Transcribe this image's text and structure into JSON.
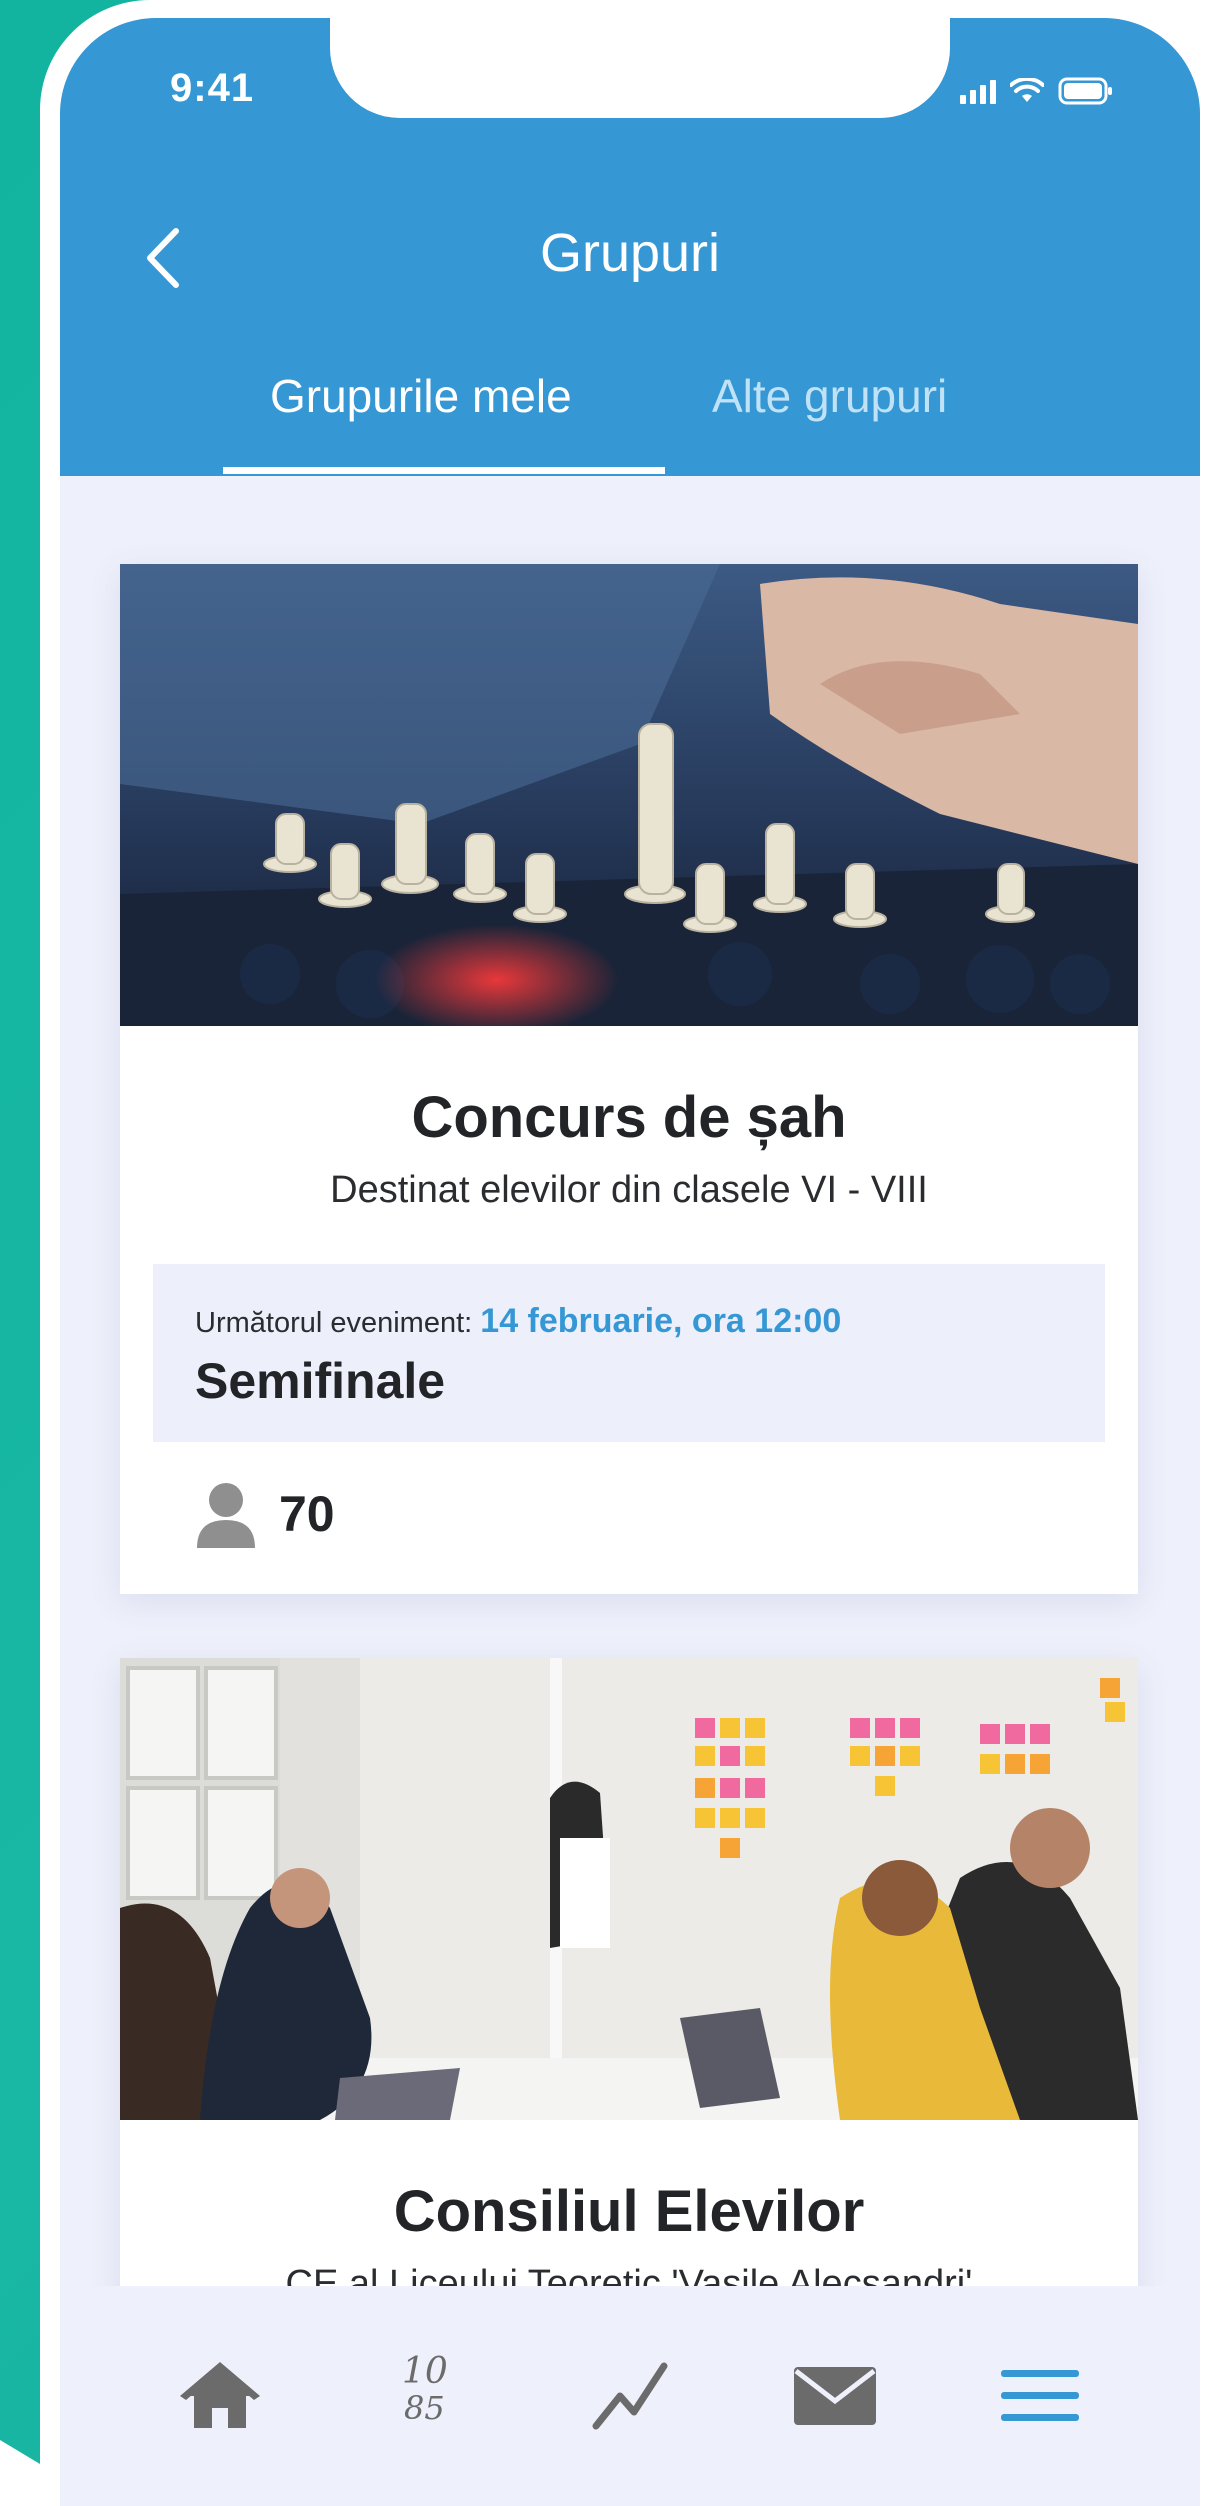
{
  "status_bar": {
    "time": "9:41"
  },
  "header": {
    "title": "Grupuri",
    "tabs": [
      {
        "label": "Grupurile mele",
        "active": true
      },
      {
        "label": "Alte grupuri",
        "active": false
      }
    ]
  },
  "groups": [
    {
      "title": "Concurs de șah",
      "subtitle": "Destinat elevilor din clasele VI - VIII",
      "image": "chess-photo",
      "event_label": "Următorul eveniment:",
      "event_date": "14 februarie, ora 12:00",
      "event_name": "Semifinale",
      "members": "70"
    },
    {
      "title": "Consiliul Elevilor",
      "subtitle": "CE al Liceului Teoretic 'Vasile Alecsandri'",
      "image": "meeting-photo"
    }
  ],
  "bottom_nav": {
    "items": [
      "home-icon",
      "grades-icon",
      "chart-icon",
      "mail-icon",
      "menu-icon"
    ],
    "grades_glyph_top": "10",
    "grades_glyph_bottom": "85"
  },
  "colors": {
    "primary": "#3597d3",
    "teal_background": "#15b5a1",
    "screen_background": "#eef0fb",
    "nav_icon": "#6b6b6b",
    "nav_active": "#3597d3"
  }
}
